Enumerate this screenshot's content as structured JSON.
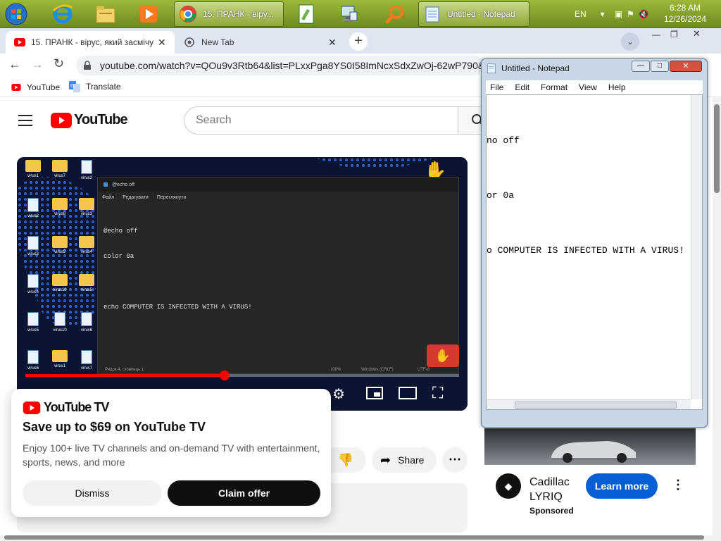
{
  "taskbar": {
    "tasks": [
      {
        "label": "15. ПРАНК - віру..."
      },
      {
        "label": "Untitled - Notepad"
      }
    ],
    "tray": {
      "lang": "EN",
      "time": "6:28 AM",
      "date": "12/26/2024"
    }
  },
  "browser": {
    "tabs": [
      {
        "label": "15. ПРАНК - вірус, який засмічу"
      },
      {
        "label": "New Tab"
      }
    ],
    "url": "youtube.com/watch?v=QOu9v3Rtb64&list=PLxxPga8YS0I58ImNcxSdxZwOj-62wP790&i",
    "bookmarks": [
      {
        "label": "YouTube"
      },
      {
        "label": "Translate"
      }
    ]
  },
  "youtube": {
    "logo_text": "YouTube",
    "search_placeholder": "Search",
    "video": {
      "files": [
        "virus1",
        "virus7",
        "virus2",
        "virus2",
        "virus8",
        "virus3",
        "virus3",
        "virus9",
        "virus4",
        "virus4",
        "virus10",
        "virus5",
        "virus5",
        "virus10",
        "virus6",
        "virus6",
        "virus1",
        "virus7"
      ],
      "editor_tab": "@echo off",
      "editor_menu": [
        "Файл",
        "Редагувати",
        "Переглянути"
      ],
      "code_lines": [
        "@echo off",
        "color 0a",
        "",
        "echo COMPUTER IS INFECTED WITH A VIRUS!"
      ],
      "status_left": "Рядок 4, стовпець 1",
      "status_mid": "100%",
      "status_right": "Windows (CRLF)",
      "status_enc": "UTF-8"
    },
    "share_label": "Share",
    "promo": {
      "logo_text": "YouTube TV",
      "title": "Save up to $69 on YouTube TV",
      "body": "Enjoy 100+ live TV channels and on-demand TV with entertainment, sports, news, and more",
      "dismiss": "Dismiss",
      "claim": "Claim offer"
    },
    "ad": {
      "brand_line1": "Cadillac",
      "brand_line2": "LYRIQ",
      "sponsored": "Sponsored",
      "cta": "Learn more"
    }
  },
  "notepad": {
    "title": "Untitled - Notepad",
    "menu": [
      "File",
      "Edit",
      "Format",
      "View",
      "Help"
    ],
    "lines": [
      "no off",
      "",
      "or 0a",
      "",
      "o COMPUTER IS INFECTED WITH A VIRUS!"
    ]
  }
}
